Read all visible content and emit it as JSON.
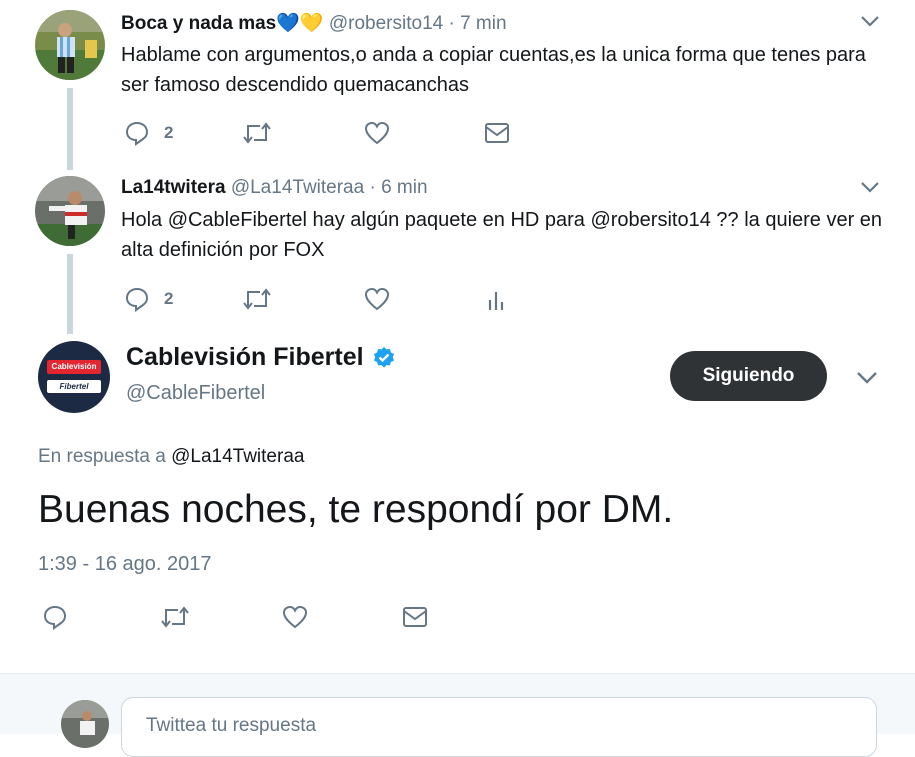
{
  "tweets": [
    {
      "name": "Boca y nada mas",
      "emoji": "💙💛",
      "handle": "@robersito14",
      "time": "· 7 min",
      "text": "Hablame con argumentos,o anda a copiar cuentas,es la unica forma que tenes para ser famoso descendido quemacanchas",
      "reply_count": "2"
    },
    {
      "name": "La14twitera",
      "handle": "@La14Twiteraa",
      "time": "· 6 min",
      "text": "Hola @CableFibertel hay algún paquete en HD para @robersito14 ?? la quiere ver en alta definición por FOX",
      "reply_count": "2"
    }
  ],
  "main_tweet": {
    "name": "Cablevisión Fibertel",
    "handle": "@CableFibertel",
    "logo_top": "Cablevisión",
    "logo_bottom": "Fibertel",
    "follow_label": "Siguiendo",
    "reply_prefix": "En respuesta a ",
    "reply_to": "@La14Twiteraa",
    "text": "Buenas noches, te respondí por DM.",
    "timestamp": "1:39 - 16 ago. 2017"
  },
  "reply_box": {
    "placeholder": "Twittea tu respuesta"
  },
  "colors": {
    "verified": "#1da1f2",
    "follow_button": "#2f3336",
    "muted": "#657786",
    "thread_line": "#ccd6dd"
  }
}
